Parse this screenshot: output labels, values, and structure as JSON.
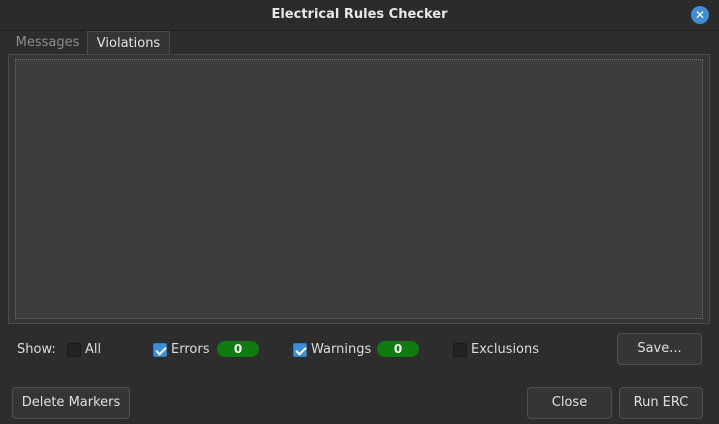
{
  "window": {
    "title": "Electrical Rules Checker",
    "close_icon": "close-icon",
    "accent": "#3e8ed6"
  },
  "tabs": [
    {
      "label": "Messages",
      "active": false
    },
    {
      "label": "Violations",
      "active": true
    }
  ],
  "violations": {
    "items": []
  },
  "filters": {
    "show_label": "Show:",
    "all": {
      "label": "All",
      "checked": false
    },
    "errors": {
      "label": "Errors",
      "checked": true,
      "count": "0"
    },
    "warnings": {
      "label": "Warnings",
      "checked": true,
      "count": "0"
    },
    "exclusions": {
      "label": "Exclusions",
      "checked": false
    },
    "badge_color": "#0f7a0f"
  },
  "buttons": {
    "save": "Save...",
    "delete_markers": "Delete Markers",
    "close": "Close",
    "run_erc": "Run ERC"
  }
}
